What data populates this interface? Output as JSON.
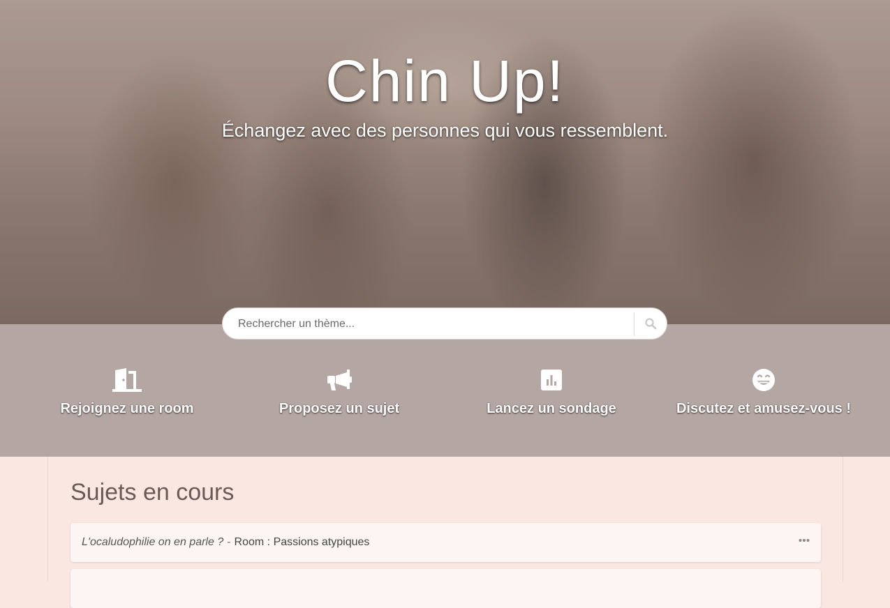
{
  "hero": {
    "title": "Chin Up!",
    "subtitle": "Échangez avec des personnes qui vous ressemblent."
  },
  "search": {
    "placeholder": "Rechercher un thème..."
  },
  "features": [
    {
      "label": "Rejoignez une room",
      "icon": "door-open-icon"
    },
    {
      "label": "Proposez un sujet",
      "icon": "megaphone-icon"
    },
    {
      "label": "Lancez un sondage",
      "icon": "poll-icon"
    },
    {
      "label": "Discutez et amusez-vous !",
      "icon": "grin-icon"
    }
  ],
  "topics_section": {
    "title": "Sujets en cours",
    "items": [
      {
        "question": "L'ocaludophilie on en parle ?",
        "separator": "-",
        "room": "Room : Passions atypiques"
      }
    ]
  },
  "colors": {
    "band": "#b4a6a2",
    "page_bg": "#fbe7e2",
    "card_bg": "#fdf5f3"
  }
}
